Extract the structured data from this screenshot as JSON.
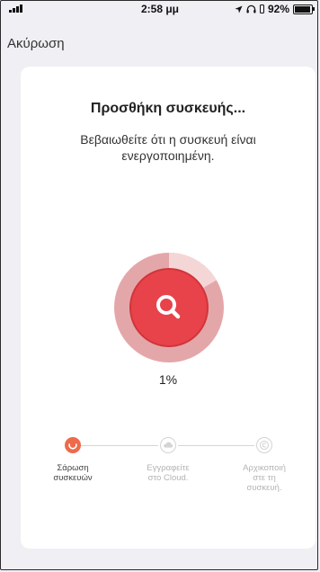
{
  "status_bar": {
    "time": "2:58 μμ",
    "battery": "92%",
    "battery_level": 0.92
  },
  "nav": {
    "cancel_label": "Ακύρωση"
  },
  "main": {
    "title": "Προσθήκη συσκευής...",
    "subtitle": "Βεβαιωθείτε ότι η συσκευή είναι ενεργοποιημένη.",
    "progress_text": "1%",
    "progress_value": 0.01,
    "scanner_icon": "search-icon"
  },
  "steps": [
    {
      "label_line1": "Σάρωση",
      "label_line2": "συσκευών",
      "label_line3": "",
      "icon": "spinner-icon",
      "state": "active"
    },
    {
      "label_line1": "Εγγραφείτε",
      "label_line2": "στο Cloud.",
      "label_line3": "",
      "icon": "cloud-icon",
      "state": "inactive"
    },
    {
      "label_line1": "Αρχικοποιή",
      "label_line2": "στε τη",
      "label_line3": "συσκευή.",
      "icon": "copyright-icon",
      "state": "inactive"
    }
  ],
  "colors": {
    "accent": "#e8434a",
    "active_step": "#ee6a4a",
    "inactive_step": "#d4d4d4",
    "background": "#efeff4"
  }
}
